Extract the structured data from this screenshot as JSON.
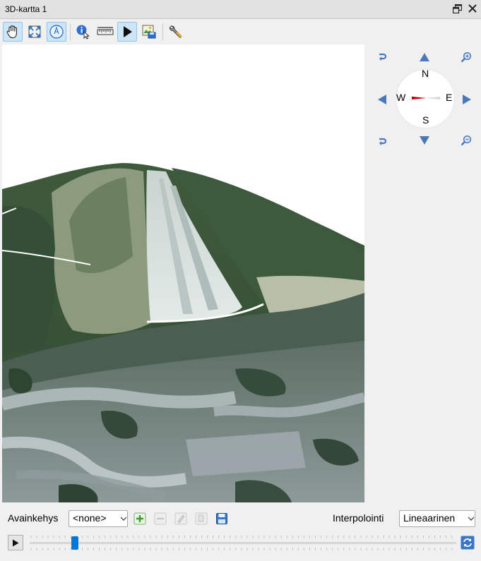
{
  "window": {
    "title": "3D-kartta 1"
  },
  "toolbar": {
    "tools": [
      {
        "icon": "pan-hand-icon",
        "active": true
      },
      {
        "icon": "zoom-full-icon",
        "active": false
      },
      {
        "icon": "camera-north-icon",
        "active": true
      },
      {
        "icon": "identify-icon",
        "active": false
      },
      {
        "icon": "measure-line-icon",
        "active": false
      },
      {
        "icon": "animation-play-icon",
        "active": true
      },
      {
        "icon": "export-scene-icon",
        "active": false
      },
      {
        "icon": "configure-wrench-icon",
        "active": false
      }
    ]
  },
  "compass": {
    "n": "N",
    "s": "S",
    "e": "E",
    "w": "W"
  },
  "keyframes": {
    "label": "Avainkehys",
    "selected": "<none>",
    "interpolation_label": "Interpolointi",
    "interpolation_value": "Lineaarinen"
  },
  "timeline": {
    "position": 0.1
  },
  "colors": {
    "accent": "#0078d7",
    "active_tool_bg": "#cde6f7",
    "nav_blue": "#4a78b8",
    "needle_red": "#e00000"
  }
}
